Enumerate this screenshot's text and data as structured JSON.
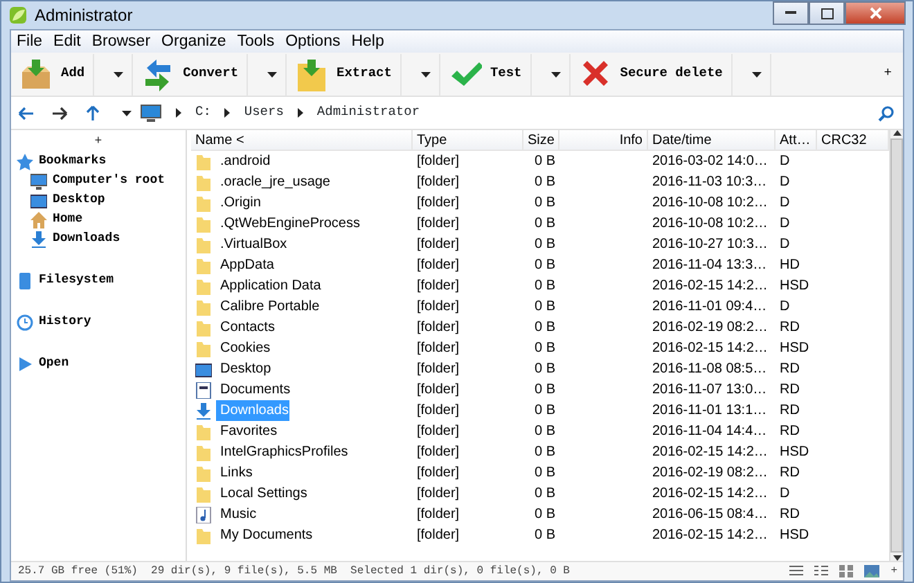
{
  "window": {
    "title": "Administrator"
  },
  "menu": [
    "File",
    "Edit",
    "Browser",
    "Organize",
    "Tools",
    "Options",
    "Help"
  ],
  "toolbar": [
    {
      "kind": "add",
      "label": "Add"
    },
    {
      "kind": "convert",
      "label": "Convert"
    },
    {
      "kind": "extract",
      "label": "Extract"
    },
    {
      "kind": "test",
      "label": "Test"
    },
    {
      "kind": "delete",
      "label": "Secure delete"
    }
  ],
  "toolbar_more": "+",
  "path": [
    "C:",
    "Users",
    "Administrator"
  ],
  "sidebar": {
    "collapse": "+",
    "items": [
      {
        "kind": "bookmarks",
        "label": "Bookmarks",
        "children": [
          {
            "kind": "computer",
            "label": "Computer's root"
          },
          {
            "kind": "desktop",
            "label": "Desktop"
          },
          {
            "kind": "home",
            "label": "Home"
          },
          {
            "kind": "downloads",
            "label": "Downloads"
          }
        ]
      },
      {
        "kind": "filesystem",
        "label": "Filesystem"
      },
      {
        "kind": "history",
        "label": "History"
      },
      {
        "kind": "open",
        "label": "Open"
      }
    ]
  },
  "table": {
    "columns": [
      "Name <",
      "Type",
      "Size",
      "Info",
      "Date/time",
      "Att…",
      "CRC32"
    ],
    "rows": [
      {
        "kind": "folder",
        "name": ".android",
        "type": "[folder]",
        "size": "0 B",
        "date": "2016-03-02 14:0…",
        "att": "D",
        "selected": false
      },
      {
        "kind": "folder",
        "name": ".oracle_jre_usage",
        "type": "[folder]",
        "size": "0 B",
        "date": "2016-11-03 10:3…",
        "att": "D",
        "selected": false
      },
      {
        "kind": "folder",
        "name": ".Origin",
        "type": "[folder]",
        "size": "0 B",
        "date": "2016-10-08 10:2…",
        "att": "D",
        "selected": false
      },
      {
        "kind": "folder",
        "name": ".QtWebEngineProcess",
        "type": "[folder]",
        "size": "0 B",
        "date": "2016-10-08 10:2…",
        "att": "D",
        "selected": false
      },
      {
        "kind": "folder",
        "name": ".VirtualBox",
        "type": "[folder]",
        "size": "0 B",
        "date": "2016-10-27 10:3…",
        "att": "D",
        "selected": false
      },
      {
        "kind": "folder",
        "name": "AppData",
        "type": "[folder]",
        "size": "0 B",
        "date": "2016-11-04 13:3…",
        "att": "HD",
        "selected": false
      },
      {
        "kind": "folder",
        "name": "Application Data",
        "type": "[folder]",
        "size": "0 B",
        "date": "2016-02-15 14:2…",
        "att": "HSD",
        "selected": false
      },
      {
        "kind": "folder",
        "name": "Calibre Portable",
        "type": "[folder]",
        "size": "0 B",
        "date": "2016-11-01 09:4…",
        "att": "D",
        "selected": false
      },
      {
        "kind": "folder",
        "name": "Contacts",
        "type": "[folder]",
        "size": "0 B",
        "date": "2016-02-19 08:2…",
        "att": "RD",
        "selected": false
      },
      {
        "kind": "folder",
        "name": "Cookies",
        "type": "[folder]",
        "size": "0 B",
        "date": "2016-02-15 14:2…",
        "att": "HSD",
        "selected": false
      },
      {
        "kind": "desktop",
        "name": "Desktop",
        "type": "[folder]",
        "size": "0 B",
        "date": "2016-11-08 08:5…",
        "att": "RD",
        "selected": false
      },
      {
        "kind": "documents",
        "name": "Documents",
        "type": "[folder]",
        "size": "0 B",
        "date": "2016-11-07 13:0…",
        "att": "RD",
        "selected": false
      },
      {
        "kind": "downloads",
        "name": "Downloads",
        "type": "[folder]",
        "size": "0 B",
        "date": "2016-11-01 13:1…",
        "att": "RD",
        "selected": true
      },
      {
        "kind": "folder",
        "name": "Favorites",
        "type": "[folder]",
        "size": "0 B",
        "date": "2016-11-04 14:4…",
        "att": "RD",
        "selected": false
      },
      {
        "kind": "folder",
        "name": "IntelGraphicsProfiles",
        "type": "[folder]",
        "size": "0 B",
        "date": "2016-02-15 14:2…",
        "att": "HSD",
        "selected": false
      },
      {
        "kind": "folder",
        "name": "Links",
        "type": "[folder]",
        "size": "0 B",
        "date": "2016-02-19 08:2…",
        "att": "RD",
        "selected": false
      },
      {
        "kind": "folder",
        "name": "Local Settings",
        "type": "[folder]",
        "size": "0 B",
        "date": "2016-02-15 14:2…",
        "att": "D",
        "selected": false
      },
      {
        "kind": "music",
        "name": "Music",
        "type": "[folder]",
        "size": "0 B",
        "date": "2016-06-15 08:4…",
        "att": "RD",
        "selected": false
      },
      {
        "kind": "folder",
        "name": "My Documents",
        "type": "[folder]",
        "size": "0 B",
        "date": "2016-02-15 14:2…",
        "att": "HSD",
        "selected": false
      }
    ]
  },
  "status_bar": {
    "text": "25.7 GB free (51%)  29 dir(s), 9 file(s), 5.5 MB  Selected 1 dir(s), 0 file(s), 0 B",
    "more": "+"
  }
}
